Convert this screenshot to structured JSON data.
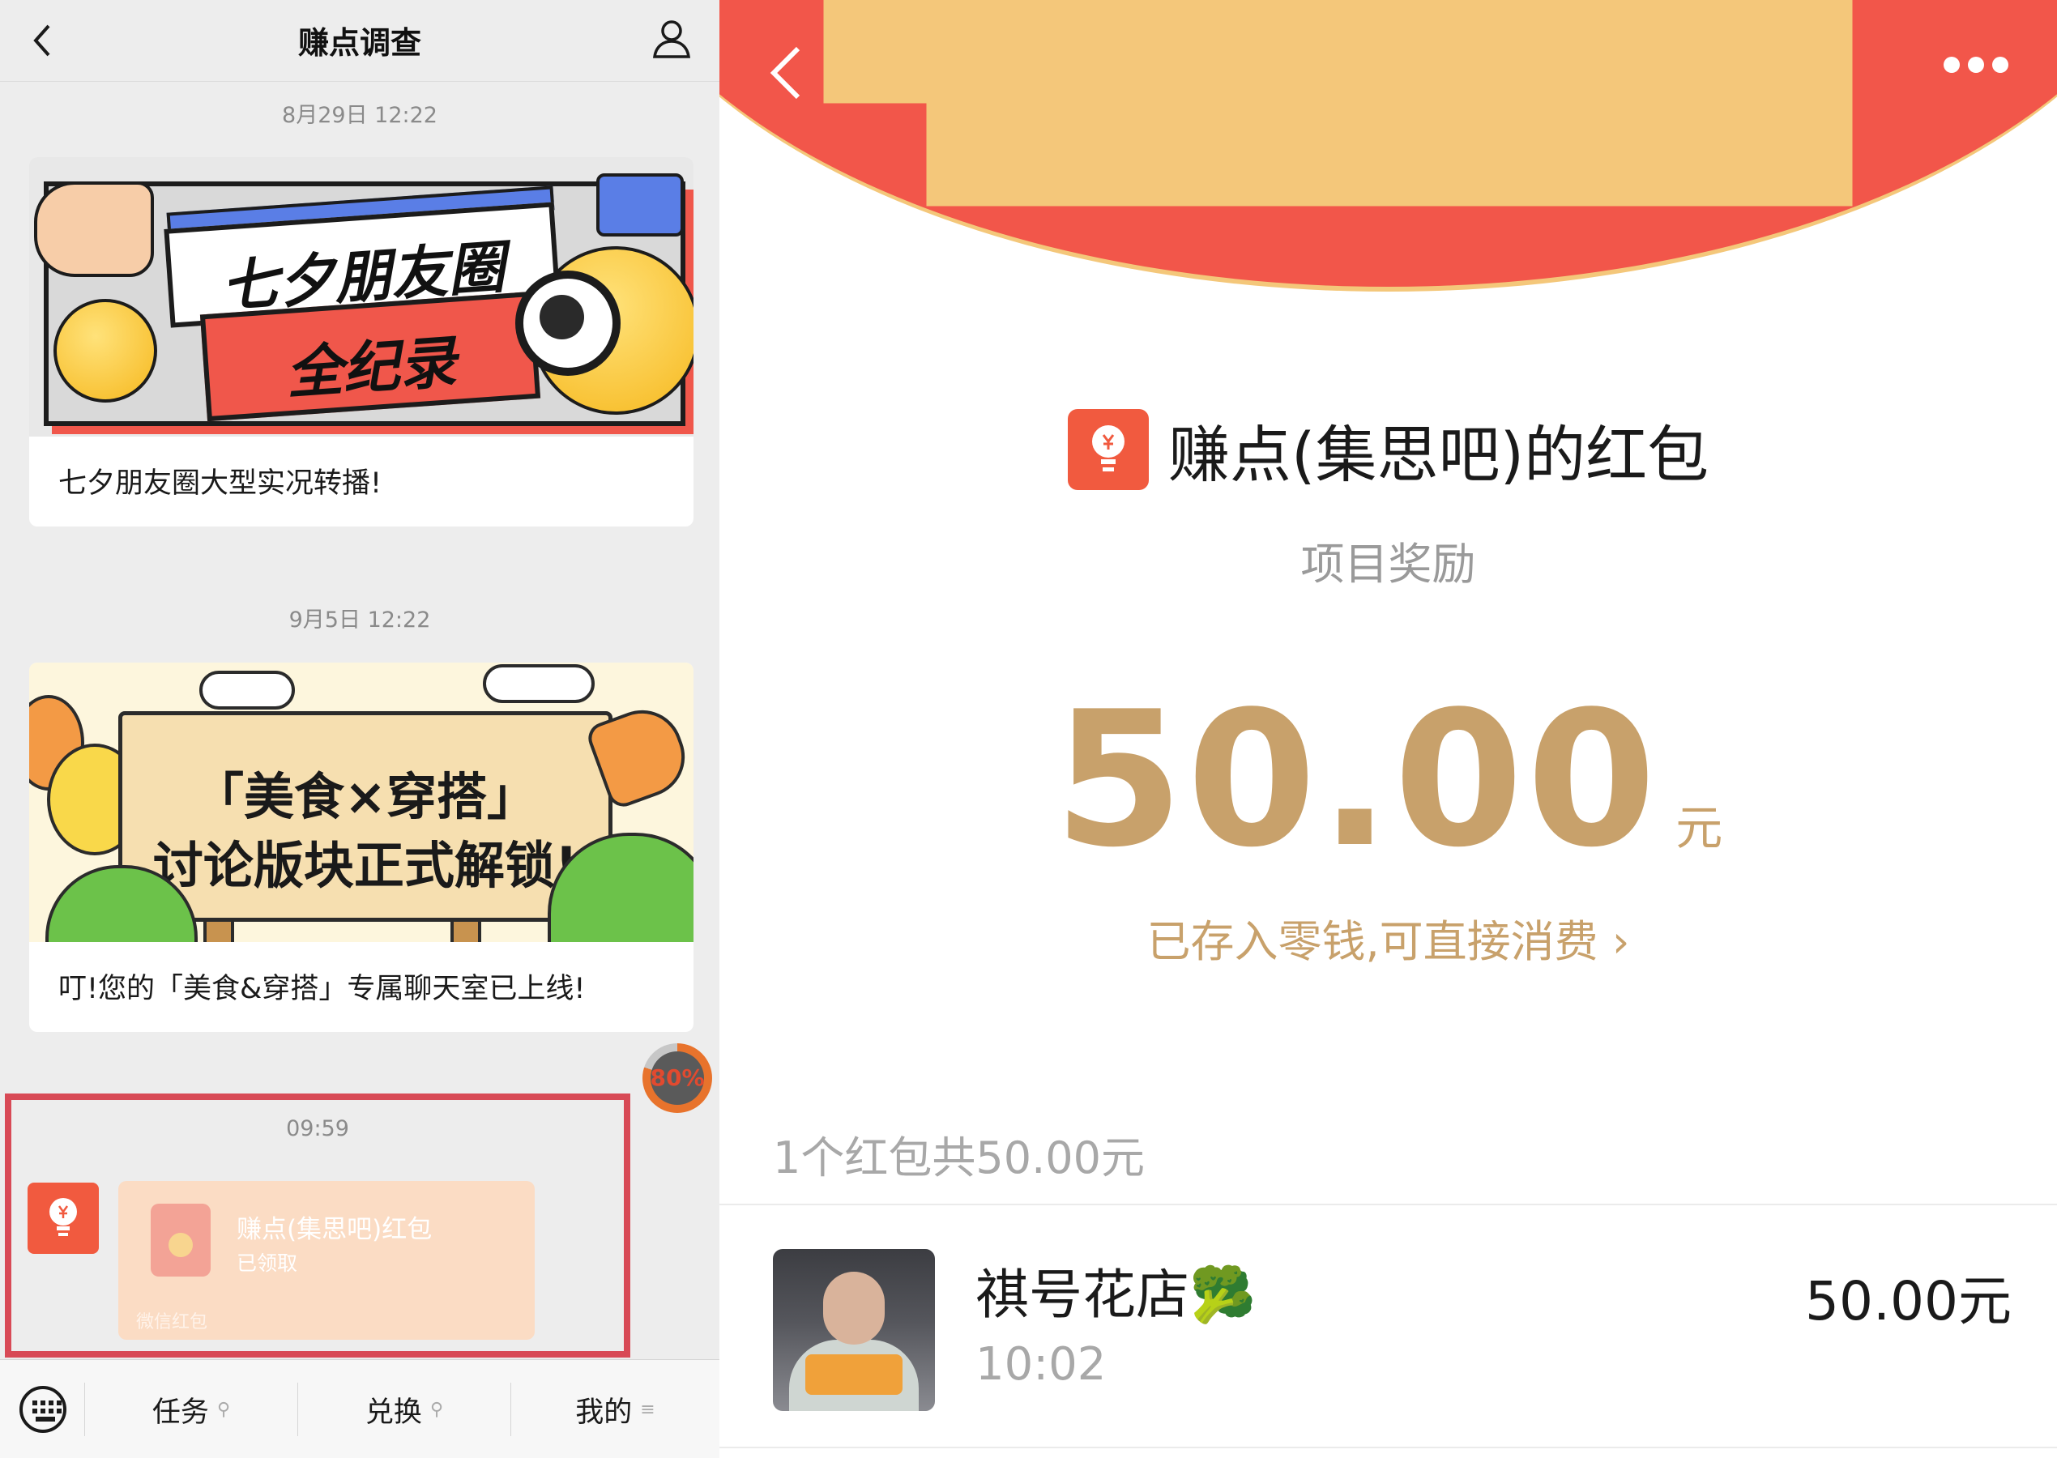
{
  "left": {
    "header": {
      "title": "赚点调查"
    },
    "messages": [
      {
        "time": "8月29日 12:22",
        "banner_line1": "七夕朋友圈",
        "banner_line2": "全纪录",
        "caption": "七夕朋友圈大型实况转播!"
      },
      {
        "time": "9月5日 12:22",
        "banner_line1": "「美食×穿搭」",
        "banner_line2": "讨论版块正式解锁!",
        "caption": "叮!您的「美食&穿搭」专属聊天室已上线!"
      }
    ],
    "progress": {
      "label": "80%",
      "value": 0.8
    },
    "red_packet": {
      "time": "09:59",
      "name": "赚点(集思吧)红包",
      "status": "已领取",
      "footer": "微信红包"
    },
    "bottom_bar": {
      "tabs": [
        "任务",
        "兑换",
        "我的"
      ]
    }
  },
  "right": {
    "title": "赚点(集思吧)的红包",
    "subtitle": "项目奖励",
    "amount": "50.00",
    "unit": "元",
    "note": "已存入零钱,可直接消费",
    "summary": "1个红包共50.00元",
    "record": {
      "name": "祺号花店🥦",
      "time": "10:02",
      "amount": "50.00元"
    }
  },
  "colors": {
    "red": "#f2564a",
    "gold": "#c8a16b",
    "highlight": "#d84a56",
    "packet": "#fbdcc4"
  }
}
